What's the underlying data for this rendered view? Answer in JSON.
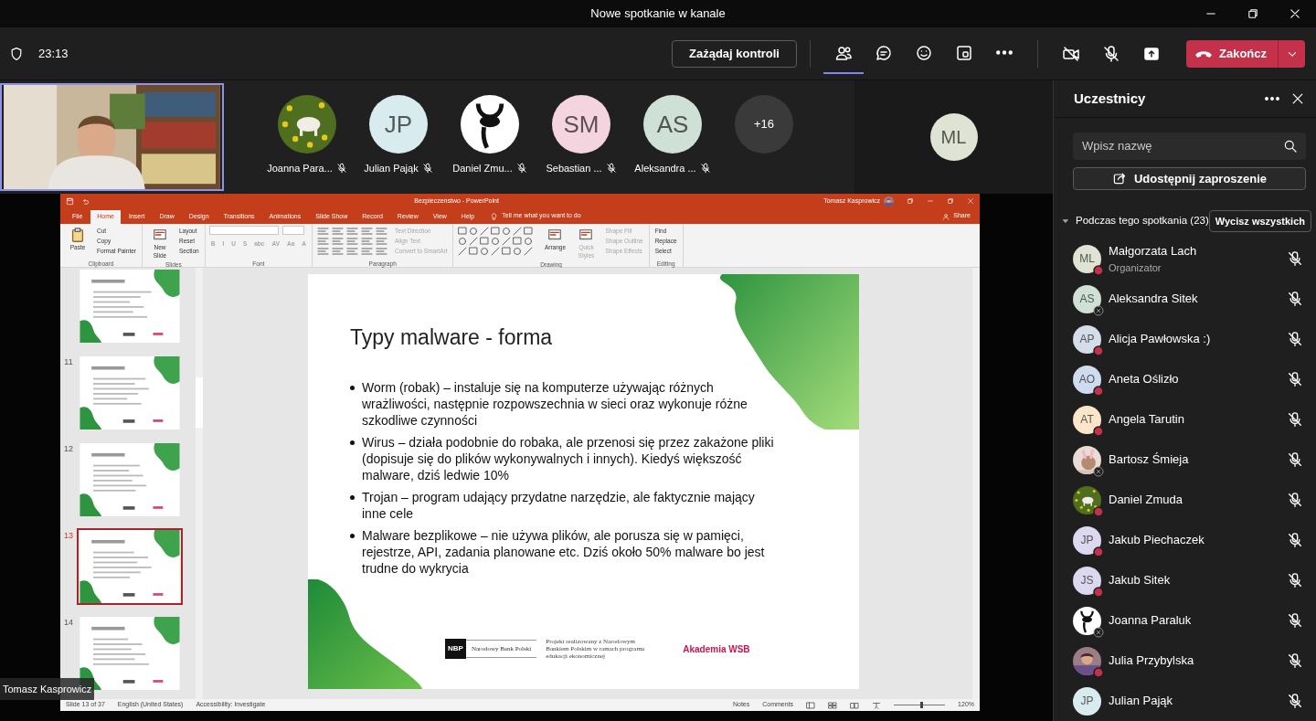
{
  "window": {
    "title": "Nowe spotkanie w kanale"
  },
  "toolbar": {
    "timer": "23:13",
    "request_control": "Zażądaj kontroli",
    "buttons": [
      {
        "kind": "people",
        "selected": true
      },
      {
        "kind": "chat",
        "selected": false
      },
      {
        "kind": "reactions",
        "selected": false
      },
      {
        "kind": "rooms",
        "selected": false
      },
      {
        "kind": "more",
        "selected": false
      }
    ],
    "media": [
      {
        "kind": "camera",
        "on": false
      },
      {
        "kind": "mic",
        "on": false
      },
      {
        "kind": "share"
      }
    ],
    "leave": "Zakończ"
  },
  "stage": {
    "participants": [
      {
        "name": "Joanna Para...",
        "muted": true
      },
      {
        "name": "Julian Pająk",
        "muted": true,
        "avatar": {
          "kind": "initials",
          "initials": "JP",
          "color": "#d8ecef"
        }
      },
      {
        "name": "Daniel Zmu...",
        "muted": true
      },
      {
        "name": "Sebastian ...",
        "muted": true,
        "avatar": {
          "kind": "initials",
          "initials": "SM",
          "color": "#f4d5df"
        }
      },
      {
        "name": "Aleksandra ...",
        "muted": true,
        "avatar": {
          "kind": "initials",
          "initials": "AS",
          "color": "#cfe0d6"
        }
      }
    ],
    "overflow": "+16",
    "pinned": {
      "kind": "initials",
      "initials": "ML",
      "color": "#dfe3d3"
    },
    "presenter": "Tomasz Kasprowicz"
  },
  "shared_screen": {
    "title": "Bezpieczenstwo - PowerPoint",
    "user": "Tomasz Kasprowicz",
    "tabs": [
      {
        "label": "File",
        "selected": false
      },
      {
        "label": "Home",
        "selected": true
      },
      {
        "label": "Insert",
        "selected": false
      },
      {
        "label": "Draw",
        "selected": false
      },
      {
        "label": "Design",
        "selected": false
      },
      {
        "label": "Transitions",
        "selected": false
      },
      {
        "label": "Animations",
        "selected": false
      },
      {
        "label": "Slide Show",
        "selected": false
      },
      {
        "label": "Record",
        "selected": false
      },
      {
        "label": "Review",
        "selected": false
      },
      {
        "label": "View",
        "selected": false
      },
      {
        "label": "Help",
        "selected": false
      }
    ],
    "tell_me": "Tell me what you want to do",
    "share": "Share",
    "ribbon": [
      {
        "label": "Clipboard",
        "items": [
          {
            "kind": "large",
            "label": "Paste",
            "disabled": false
          },
          {
            "kind": "small",
            "label": "Cut",
            "disabled": false
          },
          {
            "kind": "small",
            "label": "Copy",
            "disabled": false
          },
          {
            "kind": "small",
            "label": "Format Painter",
            "disabled": false
          }
        ]
      },
      {
        "label": "Slides",
        "items": [
          {
            "kind": "large",
            "label": "New Slide",
            "disabled": false
          },
          {
            "kind": "small",
            "label": "Layout",
            "disabled": false
          },
          {
            "kind": "small",
            "label": "Reset",
            "disabled": false
          },
          {
            "kind": "small",
            "label": "Section",
            "disabled": false
          }
        ]
      },
      {
        "label": "Font",
        "items": [
          {
            "kind": "field"
          },
          {
            "kind": "field"
          },
          {
            "kind": "glyph",
            "label": "B",
            "disabled": true
          },
          {
            "kind": "glyph",
            "label": "I",
            "disabled": true
          },
          {
            "kind": "glyph",
            "label": "U",
            "disabled": true
          },
          {
            "kind": "glyph",
            "label": "S",
            "disabled": true
          },
          {
            "kind": "glyph",
            "label": "abc",
            "disabled": true
          },
          {
            "kind": "glyph",
            "label": "AV",
            "disabled": true
          },
          {
            "kind": "glyph",
            "label": "Aa",
            "disabled": true
          },
          {
            "kind": "glyph",
            "label": "A",
            "disabled": true
          }
        ]
      },
      {
        "label": "Paragraph",
        "items": [
          {
            "kind": "gallery"
          },
          {
            "kind": "small",
            "label": "Text Direction",
            "disabled": true
          },
          {
            "kind": "small",
            "label": "Align Text",
            "disabled": true
          },
          {
            "kind": "small",
            "label": "Convert to SmartArt",
            "disabled": true
          }
        ]
      },
      {
        "label": "Drawing",
        "items": [
          {
            "kind": "gallery"
          },
          {
            "kind": "large",
            "label": "Arrange",
            "disabled": false
          },
          {
            "kind": "large",
            "label": "Quick Styles",
            "disabled": true
          },
          {
            "kind": "small",
            "label": "Shape Fill",
            "disabled": true
          },
          {
            "kind": "small",
            "label": "Shape Outline",
            "disabled": true
          },
          {
            "kind": "small",
            "label": "Shape Effects",
            "disabled": true
          }
        ]
      },
      {
        "label": "Editing",
        "items": [
          {
            "kind": "small",
            "label": "Find",
            "disabled": false
          },
          {
            "kind": "small",
            "label": "Replace",
            "disabled": false
          },
          {
            "kind": "small",
            "label": "Select",
            "disabled": false
          }
        ]
      }
    ],
    "thumbnails": [
      {
        "selected": false
      },
      {
        "number": "11",
        "selected": false
      },
      {
        "number": "12",
        "selected": false
      },
      {
        "number": "13",
        "selected": true
      },
      {
        "number": "14",
        "selected": false
      }
    ],
    "slide": {
      "title": "Typy malware - forma",
      "bullets": [
        "Worm (robak) – instaluje się na komputerze używając różnych wrażliwości, następnie rozpowszechnia w sieci oraz wykonuje różne szkodliwe czynności",
        "Wirus – działa podobnie do robaka, ale przenosi się przez zakażone pliki (dopisuje się do plików wykonywalnych i innych). Kiedyś większość malware, dziś ledwie 10%",
        "Trojan – program udający przydatne narzędzie, ale faktycznie mający inne cele",
        "Malware bezplikowe – nie używa plików, ale porusza się w pamięci, rejestrze, API, zadania planowane etc. Dziś około 50% malware bo jest trudne do wykrycia"
      ],
      "footer": {
        "logo": "NBP",
        "bank": "Narodowy Bank Polski",
        "project": "Projekt realizowany z Narodowym Bankiem Polskim w ramach programu edukacji ekonomicznej",
        "school": "Akademia WSB"
      }
    },
    "status_bar": {
      "left": [
        "Slide 13 of 37",
        "English (United States)",
        "Accessibility: Investigate"
      ],
      "notes": "Notes",
      "comments": "Comments",
      "zoom": "120%",
      "level": 0.55
    }
  },
  "panel": {
    "title": "Uczestnicy",
    "search": {
      "placeholder": "Wpisz nazwę"
    },
    "invite": "Udostępnij zaproszenie",
    "section": {
      "label": "Podczas tego spotkania (23)",
      "expanded": true
    },
    "mute_all": "Wycisz wszystkich",
    "people": [
      {
        "name": "Małgorzata Lach",
        "role": "Organizator",
        "offline": false,
        "muted": true,
        "avatar": {
          "kind": "initials",
          "initials": "ML",
          "color": "#dfe3d3"
        }
      },
      {
        "name": "Aleksandra Sitek",
        "offline": true,
        "muted": true,
        "avatar": {
          "kind": "initials",
          "initials": "AS",
          "color": "#cfe0d6"
        }
      },
      {
        "name": "Alicja Pawłowska :)",
        "offline": false,
        "muted": true,
        "avatar": {
          "kind": "initials",
          "initials": "AP",
          "color": "#d5dde8"
        }
      },
      {
        "name": "Aneta Oślizło",
        "offline": false,
        "muted": true,
        "avatar": {
          "kind": "initials",
          "initials": "AO",
          "color": "#cfdcef"
        }
      },
      {
        "name": "Angela Tarutin",
        "offline": false,
        "muted": true,
        "avatar": {
          "kind": "initials",
          "initials": "AT",
          "color": "#fbe6cc"
        }
      },
      {
        "name": "Bartosz Śmieja",
        "offline": true,
        "muted": true
      },
      {
        "name": "Daniel Zmuda",
        "offline": false,
        "muted": true
      },
      {
        "name": "Jakub Piechaczek",
        "offline": false,
        "muted": true,
        "avatar": {
          "kind": "initials",
          "initials": "JP",
          "color": "#dcd8ef"
        }
      },
      {
        "name": "Jakub Sitek",
        "offline": false,
        "muted": true,
        "avatar": {
          "kind": "initials",
          "initials": "JS",
          "color": "#dcd8ef"
        }
      },
      {
        "name": "Joanna Paraluk",
        "offline": true,
        "muted": true
      },
      {
        "name": "Julia Przybylska",
        "offline": false,
        "muted": true
      },
      {
        "name": "Julian Pająk",
        "muted": true,
        "avatar": {
          "kind": "initials",
          "initials": "JP",
          "color": "#d8ecef"
        }
      }
    ]
  }
}
